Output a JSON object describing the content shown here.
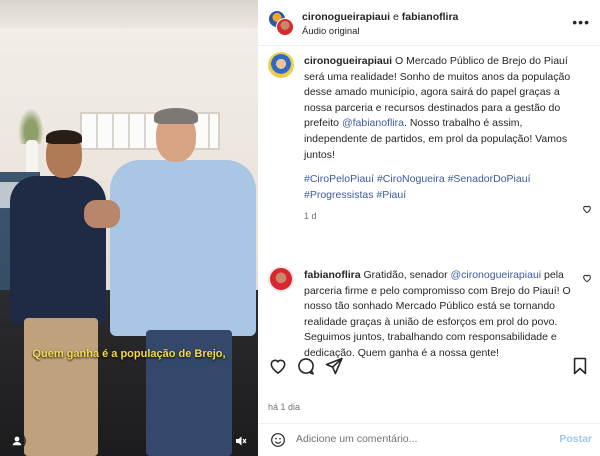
{
  "video": {
    "caption": "Quem ganha é a população de Brejo,"
  },
  "header": {
    "user1": "cironogueirapiaui",
    "conjunction": "e",
    "user2": "fabianoflira",
    "audio": "Áudio original"
  },
  "post_caption": {
    "username": "cironogueirapiaui",
    "text_1": " O Mercado Público de Brejo do Piauí será uma realidade! Sonho de muitos anos da população desse amado município, agora sairá do papel graças a nossa parceria e recursos destinados para a gestão do prefeito ",
    "mention": "@fabianoflira",
    "text_2": ". Nosso trabalho é assim, independente de partidos, em prol da população! Vamos juntos!",
    "hashtags": [
      "#CiroPeloPiauí",
      "#CiroNogueira",
      "#SenadorDoPiauí",
      "#Progressistas",
      "#Piauí"
    ],
    "time": "1 d"
  },
  "comment": {
    "username": "fabianoflira",
    "text_1": " Gratidão, senador ",
    "mention": "@cironogueirapiaui",
    "text_2": " pela parceria firme e pelo compromisso com Brejo do Piauí! O nosso tão sonhado Mercado Público está se tornando realidade graças à união de esforços em prol do povo. Seguimos juntos, trabalhando com responsabilidade e dedicação. Quem ganha é a nossa gente!"
  },
  "post_date": "há 1 dia",
  "add_comment": {
    "placeholder": "Adicione um comentário...",
    "post_label": "Postar"
  },
  "icons": [
    "more-icon",
    "heart-icon",
    "comment-icon",
    "share-icon",
    "bookmark-icon",
    "emoji-icon",
    "user-tag-icon",
    "mute-icon"
  ]
}
